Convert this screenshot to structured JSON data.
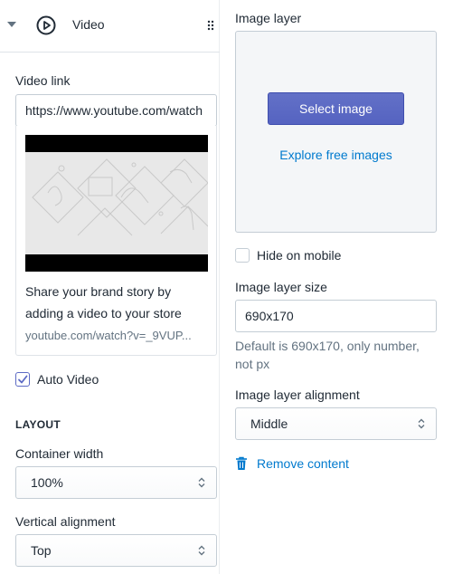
{
  "section": {
    "title": "Video"
  },
  "video_link": {
    "label": "Video link",
    "value": "https://www.youtube.com/watch"
  },
  "video_card": {
    "description": "Share your brand story by adding a video to your store",
    "link": "youtube.com/watch?v=_9VUP..."
  },
  "auto_video": {
    "label": "Auto Video",
    "checked": true
  },
  "layout": {
    "heading": "LAYOUT",
    "container_width": {
      "label": "Container width",
      "value": "100%"
    },
    "vertical_alignment": {
      "label": "Vertical alignment",
      "value": "Top"
    }
  },
  "image_layer": {
    "label": "Image layer",
    "select_button": "Select image",
    "explore_link": "Explore free images"
  },
  "hide_on_mobile": {
    "label": "Hide on mobile",
    "checked": false
  },
  "image_layer_size": {
    "label": "Image layer size",
    "value": "690x170",
    "help": "Default is 690x170, only number, not px"
  },
  "image_layer_alignment": {
    "label": "Image layer alignment",
    "value": "Middle"
  },
  "remove_content": {
    "label": "Remove content"
  },
  "colors": {
    "accent": "#5c6ac4",
    "link": "#007ace",
    "text": "#212b36",
    "muted": "#637381",
    "border": "#c4cdd5"
  }
}
